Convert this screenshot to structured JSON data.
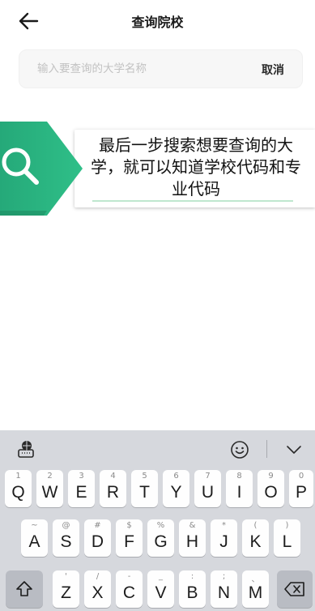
{
  "header": {
    "title": "查询院校",
    "back_icon": "arrow-left-icon"
  },
  "search": {
    "placeholder": "输入要查询的大学名称",
    "value": "",
    "cancel_label": "取消"
  },
  "tip": {
    "icon": "search-icon",
    "badge_color": "#2ab280",
    "text": "最后一步搜索想要查询的大学，就可以知道学校代码和专业代码"
  },
  "keyboard": {
    "toolbar_left_icon": "keyboard-globe-icon",
    "toolbar_right_icons": [
      "emoji-icon",
      "chevron-down-icon"
    ],
    "row1": [
      {
        "sub": "1",
        "key": "Q"
      },
      {
        "sub": "2",
        "key": "W"
      },
      {
        "sub": "3",
        "key": "E"
      },
      {
        "sub": "4",
        "key": "R"
      },
      {
        "sub": "5",
        "key": "T"
      },
      {
        "sub": "6",
        "key": "Y"
      },
      {
        "sub": "7",
        "key": "U"
      },
      {
        "sub": "8",
        "key": "I"
      },
      {
        "sub": "9",
        "key": "O"
      },
      {
        "sub": "0",
        "key": "P"
      }
    ],
    "row2": [
      {
        "sub": "~",
        "key": "A"
      },
      {
        "sub": "@",
        "key": "S"
      },
      {
        "sub": "#",
        "key": "D"
      },
      {
        "sub": "$",
        "key": "F"
      },
      {
        "sub": "%",
        "key": "G"
      },
      {
        "sub": "&",
        "key": "H"
      },
      {
        "sub": "*",
        "key": "J"
      },
      {
        "sub": "(",
        "key": "K"
      },
      {
        "sub": ")",
        "key": "L"
      }
    ],
    "row3": [
      {
        "sub": "'",
        "key": "Z"
      },
      {
        "sub": "/",
        "key": "X"
      },
      {
        "sub": "-",
        "key": "C"
      },
      {
        "sub": "_",
        "key": "V"
      },
      {
        "sub": ":",
        "key": "B"
      },
      {
        "sub": ";",
        "key": "N"
      },
      {
        "sub": "、",
        "key": "M"
      }
    ],
    "shift_icon": "shift-icon",
    "backspace_icon": "backspace-icon"
  }
}
